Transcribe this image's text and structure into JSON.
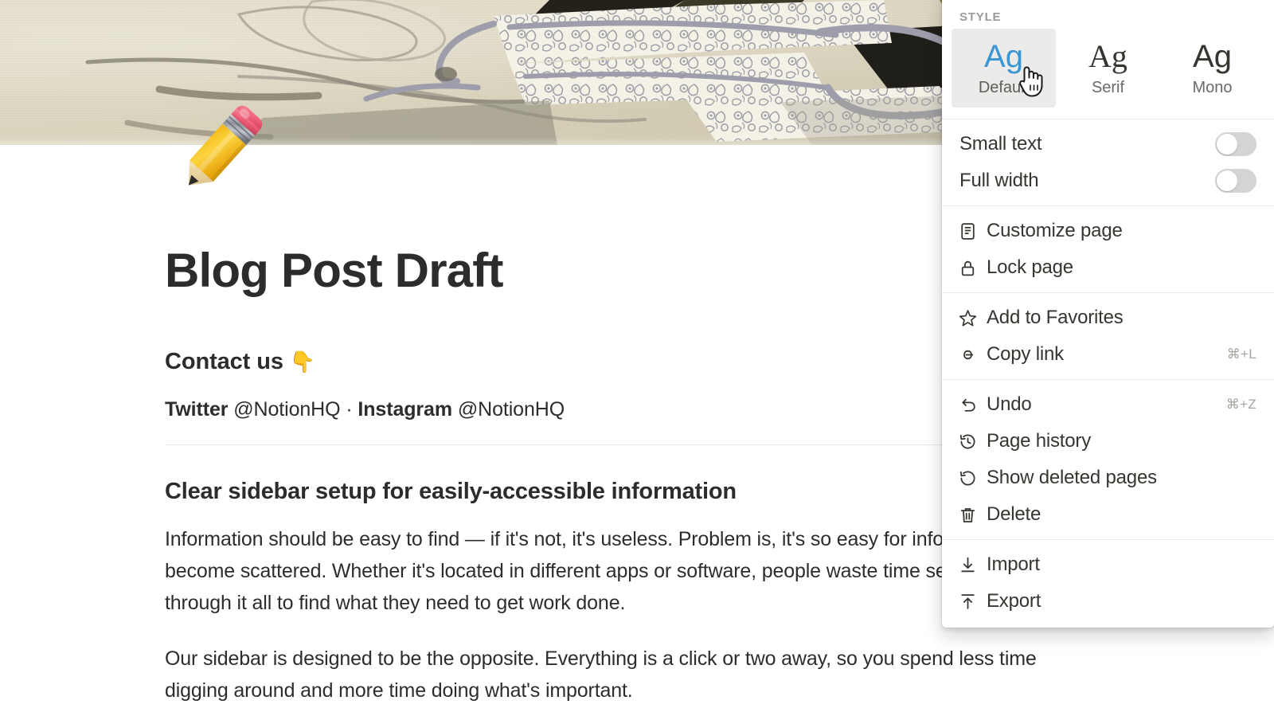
{
  "cover": {
    "alt_description": "japanese-painting-cover"
  },
  "page": {
    "icon_emoji": "✏️",
    "title": "Blog Post Draft",
    "blocks": {
      "contact_heading": "Contact us ",
      "contact_heading_emoji": "👇",
      "social_twitter_label": "Twitter",
      "social_twitter_handle": " @NotionHQ",
      "social_separator": " · ",
      "social_instagram_label": "Instagram",
      "social_instagram_handle": " @NotionHQ",
      "section_heading": "Clear sidebar setup for easily-accessible information",
      "paragraph_1": "Information should be easy to find — if it's not, it's useless. Problem is, it's so easy for information to become scattered. Whether it's located in different apps or software, people waste time searching through it all to find what they need to get work done.",
      "paragraph_2": "Our sidebar is designed to be the opposite. Everything is a click or two away, so you spend less time digging around and more time doing what's important."
    }
  },
  "panel": {
    "style_label": "STYLE",
    "style_options": [
      {
        "sample": "Ag",
        "label": "Default",
        "selected": true
      },
      {
        "sample": "Ag",
        "label": "Serif",
        "selected": false
      },
      {
        "sample": "Ag",
        "label": "Mono",
        "selected": false
      }
    ],
    "toggles": [
      {
        "label": "Small text",
        "state": "off"
      },
      {
        "label": "Full width",
        "state": "off"
      }
    ],
    "groups": [
      {
        "items": [
          {
            "icon": "customize-page-icon",
            "label": "Customize page",
            "shortcut": ""
          },
          {
            "icon": "lock-icon",
            "label": "Lock page",
            "shortcut": ""
          }
        ]
      },
      {
        "items": [
          {
            "icon": "star-icon",
            "label": "Add to Favorites",
            "shortcut": ""
          },
          {
            "icon": "link-icon",
            "label": "Copy link",
            "shortcut": "⌘+L"
          }
        ]
      },
      {
        "items": [
          {
            "icon": "undo-icon",
            "label": "Undo",
            "shortcut": "⌘+Z"
          },
          {
            "icon": "page-history-icon",
            "label": "Page history",
            "shortcut": ""
          },
          {
            "icon": "restore-icon",
            "label": "Show deleted pages",
            "shortcut": ""
          },
          {
            "icon": "trash-icon",
            "label": "Delete",
            "shortcut": ""
          }
        ]
      },
      {
        "items": [
          {
            "icon": "import-icon",
            "label": "Import",
            "shortcut": ""
          },
          {
            "icon": "export-icon",
            "label": "Export",
            "shortcut": ""
          }
        ]
      }
    ]
  },
  "colors": {
    "accent_blue": "#3b97d3",
    "text_primary": "#37352f",
    "text_muted": "#9b9a97",
    "chip_selected_bg": "#ebebea",
    "toggle_off": "#d4d4d2",
    "cover_paper": "#ddd6c0"
  },
  "cursor": {
    "type": "pointer-hand-cursor"
  }
}
